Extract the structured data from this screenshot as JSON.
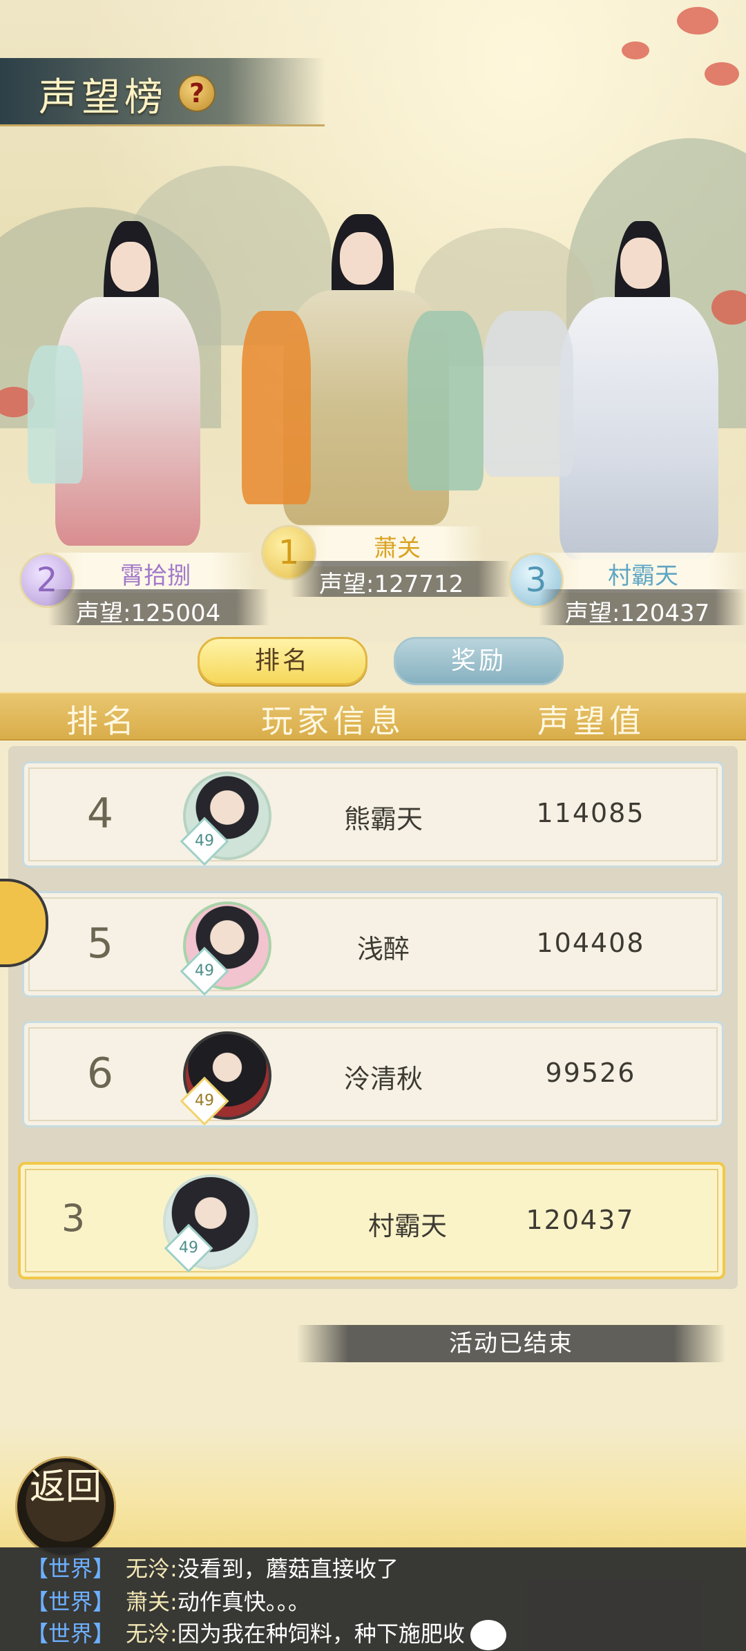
{
  "header": {
    "title": "声望榜",
    "help_icon": "?"
  },
  "podium": [
    {
      "rank": "1",
      "name": "萧关",
      "score_label": "声望:127712",
      "orb_color": "#f1cf63",
      "name_color": "#d9a322"
    },
    {
      "rank": "2",
      "name": "霄拾捌",
      "score_label": "声望:125004",
      "orb_color": "#b9a2d6",
      "name_color": "#a178c9"
    },
    {
      "rank": "3",
      "name": "村霸天",
      "score_label": "声望:120437",
      "orb_color": "#8fc3d6",
      "name_color": "#5fa6c4"
    }
  ],
  "tabs": {
    "rank": "排名",
    "reward": "奖励",
    "active": "rank"
  },
  "columns": {
    "rank": "排名",
    "info": "玩家信息",
    "score": "声望值"
  },
  "rows": [
    {
      "rank": "4",
      "level": "49",
      "name": "熊霸天",
      "score": "114085"
    },
    {
      "rank": "5",
      "level": "49",
      "name": "浅醉",
      "score": "104408"
    },
    {
      "rank": "6",
      "level": "49",
      "name": "泠清秋",
      "score": "99526"
    }
  ],
  "my_row": {
    "rank": "3",
    "level": "49",
    "name": "村霸天",
    "score": "120437"
  },
  "status": "活动已结束",
  "back_button": "返回",
  "chat": [
    {
      "channel": "【世界】",
      "sender": "无泠:",
      "text": "没看到，蘑菇直接收了"
    },
    {
      "channel": "【世界】",
      "sender": "萧关:",
      "text": "动作真快。。。"
    },
    {
      "channel": "【世界】",
      "sender": "无泠:",
      "text": "因为我在种饲料，种下施肥收"
    }
  ],
  "icons": [
    "help-icon",
    "chat-bubble-icon",
    "back-icon",
    "emoji-icon"
  ]
}
